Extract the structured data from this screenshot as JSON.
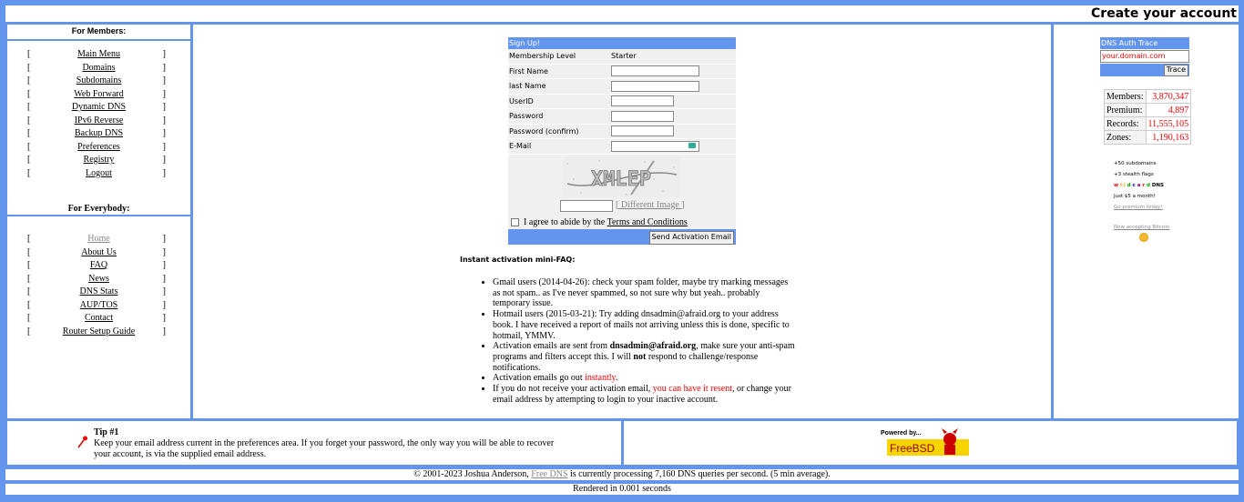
{
  "header": {
    "title": "Create your account"
  },
  "left": {
    "members_title": "For Members:",
    "members": [
      "Main Menu",
      "Domains",
      "Subdomains",
      "Web Forward",
      "Dynamic DNS",
      "IPv6 Reverse",
      "Backup DNS",
      "Preferences",
      "Registry",
      "Logout"
    ],
    "everybody_title": "For Everybody:",
    "everybody": [
      "Home",
      "About Us",
      "FAQ",
      "News",
      "DNS Stats",
      "AUP/TOS",
      "Contact",
      "Router Setup Guide"
    ],
    "bracket_left": "[",
    "bracket_right": "]"
  },
  "signup": {
    "title": "Sign Up!",
    "membership_label": "Membership Level",
    "membership_value": "Starter",
    "first_name_label": "First Name",
    "last_name_label": "last Name",
    "userid_label": "UserID",
    "password_label": "Password",
    "password_confirm_label": "Password (confirm)",
    "email_label": "E-Mail",
    "captcha_text": "XMLEP",
    "different_image": "[ Different Image ]",
    "agree_prefix": "I agree to abide by the ",
    "terms_link": "Terms and Conditions",
    "send_button": "Send Activation Email"
  },
  "faq": {
    "title": "Instant activation mini-FAQ:",
    "items": {
      "gmail": "Gmail users (2014-04-26): check your spam folder, maybe try marking messages as not spam.. as I've never spammed, so not sure why but yeah.. probably temporary issue.",
      "hotmail": "Hotmail users (2015-03-21): Try adding dnsadmin@afraid.org to your address book. I have received a report of mails not arriving unless this is done, specific to hotmail, YMMV.",
      "sent_prefix": "Activation emails are sent from ",
      "sent_email": "dnsadmin@afraid.org",
      "sent_mid": ", make sure your anti-spam programs and filters accept this. I will ",
      "sent_not": "not",
      "sent_suffix": " respond to challenge/response notifications.",
      "out_prefix": "Activation emails go out ",
      "out_instantly": "instantly",
      "out_suffix": ".",
      "resend_prefix": "If you do not receive your activation email, ",
      "resend_link": "you can have it resent",
      "resend_suffix": ", or change your email address by attempting to login to your inactive account."
    }
  },
  "trace": {
    "title": "DNS Auth Trace",
    "placeholder": "your.domain.com",
    "button": "Trace"
  },
  "stats": [
    {
      "label": "Members:",
      "value": "3,870,347"
    },
    {
      "label": "Premium:",
      "value": "4,897"
    },
    {
      "label": "Records:",
      "value": "11,555,105"
    },
    {
      "label": "Zones:",
      "value": "1,190,163"
    }
  ],
  "promo": {
    "line1": "+50 subdomains",
    "line2": "+3 stealth flags",
    "wildcard_letters": [
      "w",
      "i",
      "l",
      "d",
      "c",
      "a",
      "r",
      "d"
    ],
    "wildcard_colors": [
      "#e00",
      "#f80",
      "#cc0",
      "#0a0",
      "#00c",
      "#808",
      "#e00",
      "#0a0"
    ],
    "wildcard_suffix": " DNS",
    "line4": "Just $5 a month!",
    "link": "Go premium today!",
    "bitcoin": "Now accepting Bitcoin"
  },
  "tip": {
    "title": "Tip #1",
    "text": "Keep your email address current in the preferences area. If you forget your password, the only way you will be able to recover your account, is via the supplied email address."
  },
  "bsd": {
    "powered": "Powered by...",
    "name": "FreeBSD"
  },
  "footer": {
    "prefix": "© 2001-2023 Joshua Anderson, ",
    "link": "Free DNS",
    "suffix": " is currently processing 7,160 DNS queries per second. (5 min average).",
    "rendered": "Rendered in 0.001 seconds"
  },
  "colors": {
    "frame": "#6495ED",
    "accent_red": "#e00"
  }
}
